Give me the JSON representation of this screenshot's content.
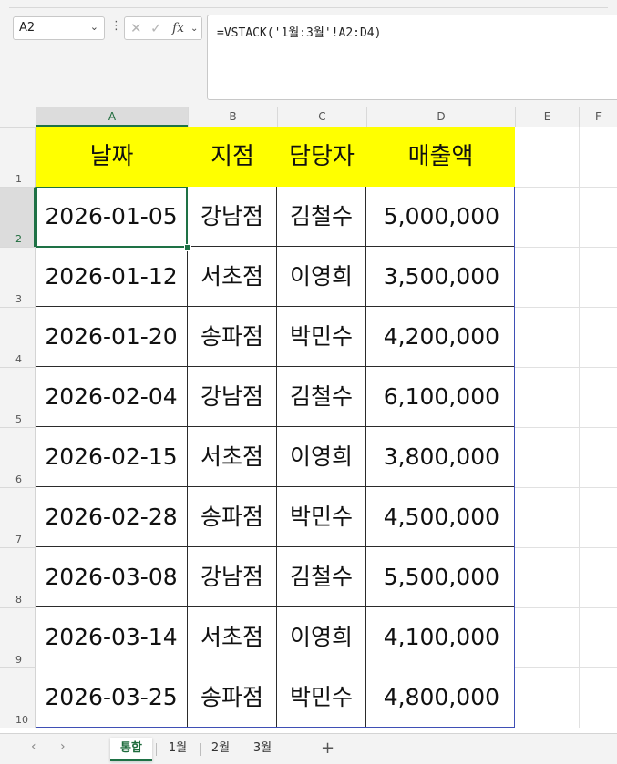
{
  "formula_bar": {
    "name_box": "A2",
    "fx_label": "fx",
    "formula": "=VSTACK('1월:3월'!A2:D4)"
  },
  "columns": [
    "A",
    "B",
    "C",
    "D",
    "E",
    "F"
  ],
  "rows": [
    "1",
    "2",
    "3",
    "4",
    "5",
    "6",
    "7",
    "8",
    "9",
    "10"
  ],
  "table": {
    "headers": [
      "날짜",
      "지점",
      "담당자",
      "매출액"
    ],
    "header_fill": "#ffff00",
    "rows": [
      [
        "2026-01-05",
        "강남점",
        "김철수",
        "5,000,000"
      ],
      [
        "2026-01-12",
        "서초점",
        "이영희",
        "3,500,000"
      ],
      [
        "2026-01-20",
        "송파점",
        "박민수",
        "4,200,000"
      ],
      [
        "2026-02-04",
        "강남점",
        "김철수",
        "6,100,000"
      ],
      [
        "2026-02-15",
        "서초점",
        "이영희",
        "3,800,000"
      ],
      [
        "2026-02-28",
        "송파점",
        "박민수",
        "4,500,000"
      ],
      [
        "2026-03-08",
        "강남점",
        "김철수",
        "5,500,000"
      ],
      [
        "2026-03-14",
        "서초점",
        "이영희",
        "4,100,000"
      ],
      [
        "2026-03-25",
        "송파점",
        "박민수",
        "4,800,000"
      ]
    ]
  },
  "sheet_tabs": [
    "통합",
    "1월",
    "2월",
    "3월"
  ],
  "active_tab": "통합",
  "accent_color": "#1e7145"
}
